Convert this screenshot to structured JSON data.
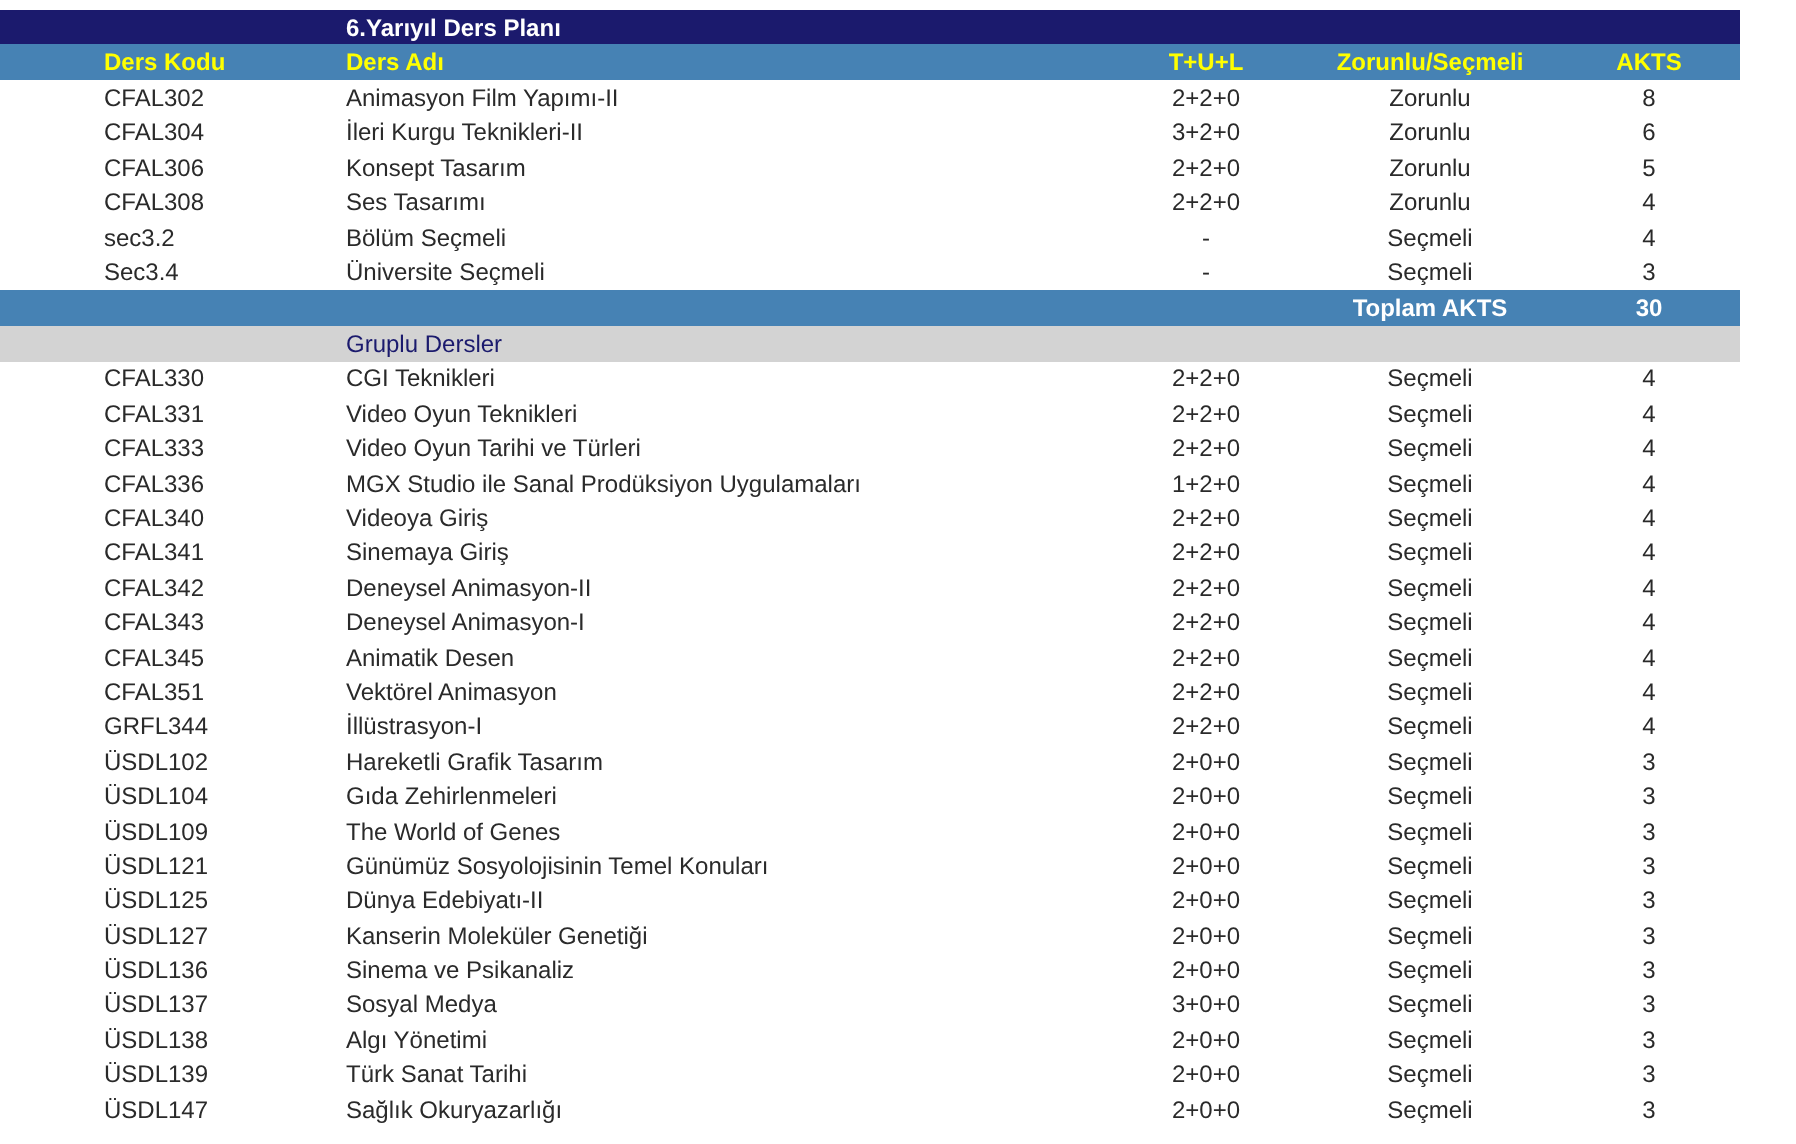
{
  "title": "6.Yarıyıl Ders Planı",
  "columns": [
    "Ders Kodu",
    "Ders Adı",
    "T+U+L",
    "Zorunlu/Seçmeli",
    "AKTS"
  ],
  "rows": [
    {
      "code": "CFAL302",
      "name": "Animasyon Film Yapımı-II",
      "tul": "2+2+0",
      "type": "Zorunlu",
      "akts": "8"
    },
    {
      "code": "CFAL304",
      "name": "İleri Kurgu Teknikleri-II",
      "tul": "3+2+0",
      "type": "Zorunlu",
      "akts": "6"
    },
    {
      "code": "CFAL306",
      "name": "Konsept Tasarım",
      "tul": "2+2+0",
      "type": "Zorunlu",
      "akts": "5"
    },
    {
      "code": "CFAL308",
      "name": "Ses Tasarımı",
      "tul": "2+2+0",
      "type": "Zorunlu",
      "akts": "4"
    },
    {
      "code": "sec3.2",
      "name": "Bölüm Seçmeli",
      "tul": "-",
      "type": "Seçmeli",
      "akts": "4"
    },
    {
      "code": "Sec3.4",
      "name": "Üniversite Seçmeli",
      "tul": "-",
      "type": "Seçmeli",
      "akts": "3"
    }
  ],
  "total": {
    "label": "Toplam AKTS",
    "value": "30"
  },
  "group": {
    "title": "Gruplu Dersler",
    "rows": [
      {
        "code": "CFAL330",
        "name": "CGI Teknikleri",
        "tul": "2+2+0",
        "type": "Seçmeli",
        "akts": "4"
      },
      {
        "code": "CFAL331",
        "name": "Video Oyun Teknikleri",
        "tul": "2+2+0",
        "type": "Seçmeli",
        "akts": "4"
      },
      {
        "code": "CFAL333",
        "name": "Video Oyun Tarihi ve Türleri",
        "tul": "2+2+0",
        "type": "Seçmeli",
        "akts": "4"
      },
      {
        "code": "CFAL336",
        "name": "MGX Studio ile Sanal Prodüksiyon Uygulamaları",
        "tul": "1+2+0",
        "type": "Seçmeli",
        "akts": "4"
      },
      {
        "code": "CFAL340",
        "name": "Videoya Giriş",
        "tul": "2+2+0",
        "type": "Seçmeli",
        "akts": "4"
      },
      {
        "code": "CFAL341",
        "name": "Sinemaya Giriş",
        "tul": "2+2+0",
        "type": "Seçmeli",
        "akts": "4"
      },
      {
        "code": "CFAL342",
        "name": "Deneysel Animasyon-II",
        "tul": "2+2+0",
        "type": "Seçmeli",
        "akts": "4"
      },
      {
        "code": "CFAL343",
        "name": "Deneysel Animasyon-I",
        "tul": "2+2+0",
        "type": "Seçmeli",
        "akts": "4"
      },
      {
        "code": "CFAL345",
        "name": "Animatik Desen",
        "tul": "2+2+0",
        "type": "Seçmeli",
        "akts": "4"
      },
      {
        "code": "CFAL351",
        "name": "Vektörel Animasyon",
        "tul": "2+2+0",
        "type": "Seçmeli",
        "akts": "4"
      },
      {
        "code": "GRFL344",
        "name": "İllüstrasyon-I",
        "tul": "2+2+0",
        "type": "Seçmeli",
        "akts": "4"
      },
      {
        "code": "ÜSDL102",
        "name": "Hareketli Grafik Tasarım",
        "tul": "2+0+0",
        "type": "Seçmeli",
        "akts": "3"
      },
      {
        "code": "ÜSDL104",
        "name": "Gıda Zehirlenmeleri",
        "tul": "2+0+0",
        "type": "Seçmeli",
        "akts": "3"
      },
      {
        "code": "ÜSDL109",
        "name": "The World of Genes",
        "tul": "2+0+0",
        "type": "Seçmeli",
        "akts": "3"
      },
      {
        "code": "ÜSDL121",
        "name": "Günümüz Sosyolojisinin Temel Konuları",
        "tul": "2+0+0",
        "type": "Seçmeli",
        "akts": "3"
      },
      {
        "code": "ÜSDL125",
        "name": "Dünya Edebiyatı-II",
        "tul": "2+0+0",
        "type": "Seçmeli",
        "akts": "3"
      },
      {
        "code": "ÜSDL127",
        "name": "Kanserin Moleküler Genetiği",
        "tul": "2+0+0",
        "type": "Seçmeli",
        "akts": "3"
      },
      {
        "code": "ÜSDL136",
        "name": "Sinema ve Psikanaliz",
        "tul": "2+0+0",
        "type": "Seçmeli",
        "akts": "3"
      },
      {
        "code": "ÜSDL137",
        "name": "Sosyal Medya",
        "tul": "3+0+0",
        "type": "Seçmeli",
        "akts": "3"
      },
      {
        "code": "ÜSDL138",
        "name": "Algı Yönetimi",
        "tul": "2+0+0",
        "type": "Seçmeli",
        "akts": "3"
      },
      {
        "code": "ÜSDL139",
        "name": "Türk Sanat Tarihi",
        "tul": "2+0+0",
        "type": "Seçmeli",
        "akts": "3"
      },
      {
        "code": "ÜSDL147",
        "name": "Sağlık Okuryazarlığı",
        "tul": "2+0+0",
        "type": "Seçmeli",
        "akts": "3"
      }
    ]
  }
}
